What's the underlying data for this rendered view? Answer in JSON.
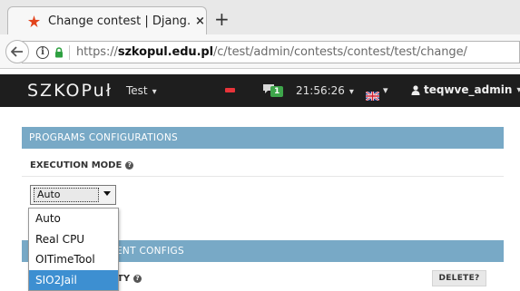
{
  "browser": {
    "tab_title": "Change contest | Djang…",
    "tab_close": "×",
    "new_tab": "+",
    "url_host": "szkopul.edu.pl",
    "url_prefix": "https://",
    "url_path": "/c/test/admin/contests/contest/test/change/"
  },
  "header": {
    "logo": "SZKOPuł",
    "contest_menu": "Test",
    "message_count": "1",
    "clock": "21:56:26",
    "user": "teqwve_admin",
    "accent_red": "#e8343a",
    "badge_green": "#3ea64b"
  },
  "programs": {
    "section_title": "PROGRAMS CONFIGURATIONS",
    "field_label": "EXECUTION MODE",
    "selected_value": "Auto",
    "options": [
      "Auto",
      "Real CPU",
      "OITimeTool",
      "SIO2Jail"
    ],
    "highlighted_option": "SIO2Jail"
  },
  "next_section": {
    "title_fragment": "ENT CONFIGS",
    "field_fragment": "TY",
    "delete_label": "DELETE?"
  },
  "colors": {
    "panel_header": "#78a9c6",
    "app_header_bg": "#1e1e1e",
    "dropdown_highlight": "#3d8fd1"
  }
}
